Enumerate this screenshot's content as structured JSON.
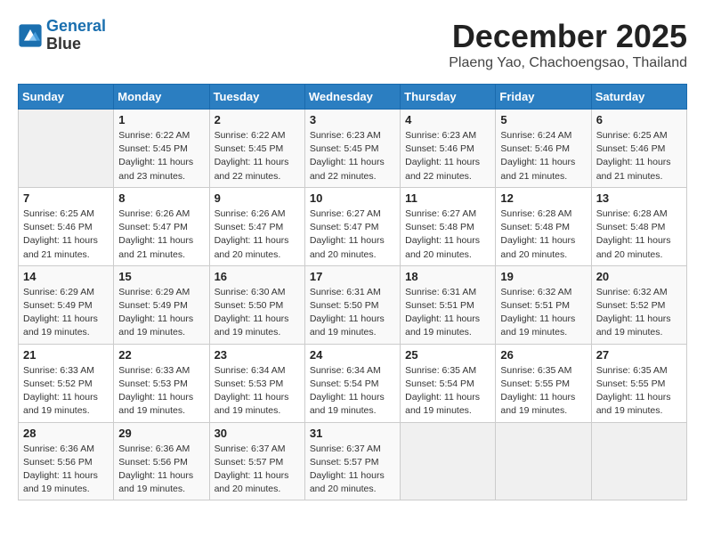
{
  "logo": {
    "line1": "General",
    "line2": "Blue"
  },
  "title": "December 2025",
  "location": "Plaeng Yao, Chachoengsao, Thailand",
  "headers": [
    "Sunday",
    "Monday",
    "Tuesday",
    "Wednesday",
    "Thursday",
    "Friday",
    "Saturday"
  ],
  "weeks": [
    [
      {
        "day": "",
        "info": ""
      },
      {
        "day": "1",
        "info": "Sunrise: 6:22 AM\nSunset: 5:45 PM\nDaylight: 11 hours\nand 23 minutes."
      },
      {
        "day": "2",
        "info": "Sunrise: 6:22 AM\nSunset: 5:45 PM\nDaylight: 11 hours\nand 22 minutes."
      },
      {
        "day": "3",
        "info": "Sunrise: 6:23 AM\nSunset: 5:45 PM\nDaylight: 11 hours\nand 22 minutes."
      },
      {
        "day": "4",
        "info": "Sunrise: 6:23 AM\nSunset: 5:46 PM\nDaylight: 11 hours\nand 22 minutes."
      },
      {
        "day": "5",
        "info": "Sunrise: 6:24 AM\nSunset: 5:46 PM\nDaylight: 11 hours\nand 21 minutes."
      },
      {
        "day": "6",
        "info": "Sunrise: 6:25 AM\nSunset: 5:46 PM\nDaylight: 11 hours\nand 21 minutes."
      }
    ],
    [
      {
        "day": "7",
        "info": "Sunrise: 6:25 AM\nSunset: 5:46 PM\nDaylight: 11 hours\nand 21 minutes."
      },
      {
        "day": "8",
        "info": "Sunrise: 6:26 AM\nSunset: 5:47 PM\nDaylight: 11 hours\nand 21 minutes."
      },
      {
        "day": "9",
        "info": "Sunrise: 6:26 AM\nSunset: 5:47 PM\nDaylight: 11 hours\nand 20 minutes."
      },
      {
        "day": "10",
        "info": "Sunrise: 6:27 AM\nSunset: 5:47 PM\nDaylight: 11 hours\nand 20 minutes."
      },
      {
        "day": "11",
        "info": "Sunrise: 6:27 AM\nSunset: 5:48 PM\nDaylight: 11 hours\nand 20 minutes."
      },
      {
        "day": "12",
        "info": "Sunrise: 6:28 AM\nSunset: 5:48 PM\nDaylight: 11 hours\nand 20 minutes."
      },
      {
        "day": "13",
        "info": "Sunrise: 6:28 AM\nSunset: 5:48 PM\nDaylight: 11 hours\nand 20 minutes."
      }
    ],
    [
      {
        "day": "14",
        "info": "Sunrise: 6:29 AM\nSunset: 5:49 PM\nDaylight: 11 hours\nand 19 minutes."
      },
      {
        "day": "15",
        "info": "Sunrise: 6:29 AM\nSunset: 5:49 PM\nDaylight: 11 hours\nand 19 minutes."
      },
      {
        "day": "16",
        "info": "Sunrise: 6:30 AM\nSunset: 5:50 PM\nDaylight: 11 hours\nand 19 minutes."
      },
      {
        "day": "17",
        "info": "Sunrise: 6:31 AM\nSunset: 5:50 PM\nDaylight: 11 hours\nand 19 minutes."
      },
      {
        "day": "18",
        "info": "Sunrise: 6:31 AM\nSunset: 5:51 PM\nDaylight: 11 hours\nand 19 minutes."
      },
      {
        "day": "19",
        "info": "Sunrise: 6:32 AM\nSunset: 5:51 PM\nDaylight: 11 hours\nand 19 minutes."
      },
      {
        "day": "20",
        "info": "Sunrise: 6:32 AM\nSunset: 5:52 PM\nDaylight: 11 hours\nand 19 minutes."
      }
    ],
    [
      {
        "day": "21",
        "info": "Sunrise: 6:33 AM\nSunset: 5:52 PM\nDaylight: 11 hours\nand 19 minutes."
      },
      {
        "day": "22",
        "info": "Sunrise: 6:33 AM\nSunset: 5:53 PM\nDaylight: 11 hours\nand 19 minutes."
      },
      {
        "day": "23",
        "info": "Sunrise: 6:34 AM\nSunset: 5:53 PM\nDaylight: 11 hours\nand 19 minutes."
      },
      {
        "day": "24",
        "info": "Sunrise: 6:34 AM\nSunset: 5:54 PM\nDaylight: 11 hours\nand 19 minutes."
      },
      {
        "day": "25",
        "info": "Sunrise: 6:35 AM\nSunset: 5:54 PM\nDaylight: 11 hours\nand 19 minutes."
      },
      {
        "day": "26",
        "info": "Sunrise: 6:35 AM\nSunset: 5:55 PM\nDaylight: 11 hours\nand 19 minutes."
      },
      {
        "day": "27",
        "info": "Sunrise: 6:35 AM\nSunset: 5:55 PM\nDaylight: 11 hours\nand 19 minutes."
      }
    ],
    [
      {
        "day": "28",
        "info": "Sunrise: 6:36 AM\nSunset: 5:56 PM\nDaylight: 11 hours\nand 19 minutes."
      },
      {
        "day": "29",
        "info": "Sunrise: 6:36 AM\nSunset: 5:56 PM\nDaylight: 11 hours\nand 19 minutes."
      },
      {
        "day": "30",
        "info": "Sunrise: 6:37 AM\nSunset: 5:57 PM\nDaylight: 11 hours\nand 20 minutes."
      },
      {
        "day": "31",
        "info": "Sunrise: 6:37 AM\nSunset: 5:57 PM\nDaylight: 11 hours\nand 20 minutes."
      },
      {
        "day": "",
        "info": ""
      },
      {
        "day": "",
        "info": ""
      },
      {
        "day": "",
        "info": ""
      }
    ]
  ]
}
